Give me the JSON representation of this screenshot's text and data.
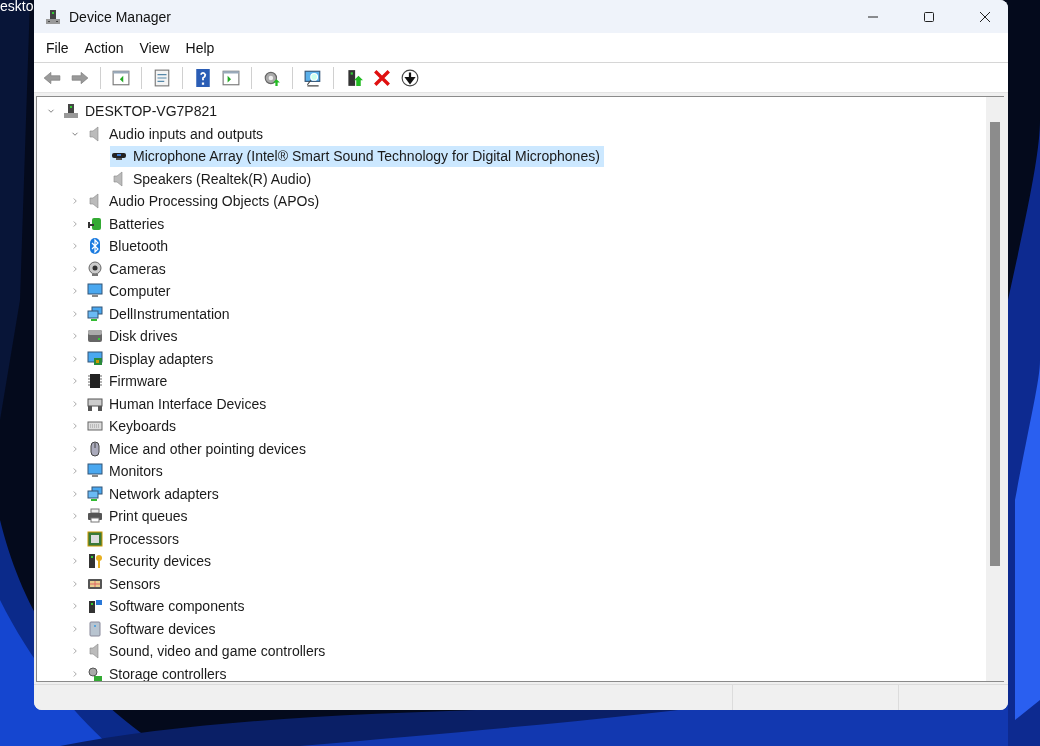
{
  "desktop": {
    "icon_label": "eskto"
  },
  "window": {
    "title": "Device Manager"
  },
  "menu": [
    {
      "label": "File"
    },
    {
      "label": "Action"
    },
    {
      "label": "View"
    },
    {
      "label": "Help"
    }
  ],
  "tree": [
    {
      "label": "DESKTOP-VG7P821",
      "expanded": true,
      "selected": false,
      "children": [
        {
          "label": "Audio inputs and outputs",
          "expanded": true,
          "selected": false,
          "children": [
            {
              "label": "Microphone Array (Intel® Smart Sound Technology for Digital Microphones)",
              "selected": true
            },
            {
              "label": "Speakers (Realtek(R) Audio)",
              "selected": false
            }
          ]
        },
        {
          "label": "Audio Processing Objects (APOs)",
          "expanded": false,
          "selected": false
        },
        {
          "label": "Batteries",
          "expanded": false,
          "selected": false
        },
        {
          "label": "Bluetooth",
          "expanded": false,
          "selected": false
        },
        {
          "label": "Cameras",
          "expanded": false,
          "selected": false
        },
        {
          "label": "Computer",
          "expanded": false,
          "selected": false
        },
        {
          "label": "DellInstrumentation",
          "expanded": false,
          "selected": false
        },
        {
          "label": "Disk drives",
          "expanded": false,
          "selected": false
        },
        {
          "label": "Display adapters",
          "expanded": false,
          "selected": false
        },
        {
          "label": "Firmware",
          "expanded": false,
          "selected": false
        },
        {
          "label": "Human Interface Devices",
          "expanded": false,
          "selected": false
        },
        {
          "label": "Keyboards",
          "expanded": false,
          "selected": false
        },
        {
          "label": "Mice and other pointing devices",
          "expanded": false,
          "selected": false
        },
        {
          "label": "Monitors",
          "expanded": false,
          "selected": false
        },
        {
          "label": "Network adapters",
          "expanded": false,
          "selected": false
        },
        {
          "label": "Print queues",
          "expanded": false,
          "selected": false
        },
        {
          "label": "Processors",
          "expanded": false,
          "selected": false
        },
        {
          "label": "Security devices",
          "expanded": false,
          "selected": false
        },
        {
          "label": "Sensors",
          "expanded": false,
          "selected": false
        },
        {
          "label": "Software components",
          "expanded": false,
          "selected": false
        },
        {
          "label": "Software devices",
          "expanded": false,
          "selected": false
        },
        {
          "label": "Sound, video and game controllers",
          "expanded": false,
          "selected": false
        },
        {
          "label": "Storage controllers",
          "expanded": false,
          "selected": false
        }
      ]
    }
  ]
}
